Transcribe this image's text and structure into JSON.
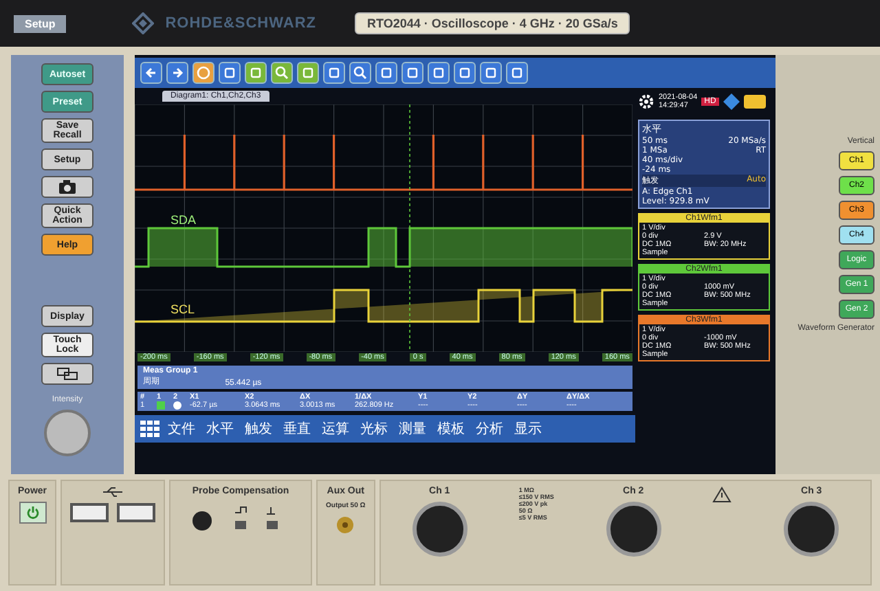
{
  "brand": "ROHDE&SCHWARZ",
  "model_label": "RTO2044 · Oscilloscope · 4 GHz · 20 GSa/s",
  "left_panel": {
    "title": "Setup",
    "buttons": [
      {
        "kind": "teal",
        "label": "Autoset"
      },
      {
        "kind": "teal",
        "label": "Preset"
      },
      {
        "kind": "grey",
        "label": "Save Recall"
      },
      {
        "kind": "grey",
        "label": "Setup"
      },
      {
        "kind": "camera"
      },
      {
        "kind": "grey",
        "label": "Quick Action"
      },
      {
        "kind": "orange",
        "label": "Help"
      },
      {
        "kind": "gap"
      },
      {
        "kind": "grey",
        "label": "Display"
      },
      {
        "kind": "light",
        "label": "Touch Lock"
      },
      {
        "kind": "windows"
      }
    ],
    "knob_label": "Intensity"
  },
  "screen": {
    "diagram_tab": "Diagram1: Ch1,Ch2,Ch3",
    "trace_labels": [
      "SDA",
      "SCL"
    ],
    "time_ticks": [
      "-200 ms",
      "-160 ms",
      "-120 ms",
      "-80 ms",
      "-40 ms",
      "0 s",
      "40 ms",
      "80 ms",
      "120 ms",
      "160 ms"
    ],
    "meas_group": {
      "title": "Meas Group 1",
      "row_label": "周期",
      "value": "55.442 µs"
    },
    "cursor_table": {
      "columns": [
        "#",
        "1",
        "2",
        "X1",
        "X2",
        "ΔX",
        "1/ΔX",
        "Y1",
        "Y2",
        "ΔY",
        "ΔY/ΔX"
      ],
      "row_index": "1",
      "row": [
        "-62.7 µs",
        "3.0643 ms",
        "3.0013 ms",
        "262.809 Hz",
        "----",
        "----",
        "----",
        "----"
      ]
    },
    "menu": [
      "文件",
      "水平",
      "触发",
      "垂直",
      "运算",
      "光标",
      "测量",
      "模板",
      "分析",
      "显示"
    ],
    "side_panel": {
      "date": "2021-08-04",
      "time": "14:29:47",
      "hd_badge": "HD",
      "horizontal": {
        "title": "水平",
        "rows": [
          [
            "50 ms",
            "20 MSa/s"
          ],
          [
            "1 MSa",
            "RT"
          ],
          [
            "40 ms/div",
            ""
          ],
          [
            "-24 ms",
            ""
          ]
        ]
      },
      "trigger": {
        "title": "触发",
        "mode": "Auto",
        "source": "A:   Edge  Ch1",
        "level": "Level: 929.8 mV"
      },
      "channels": [
        {
          "name": "Ch1Wfm1",
          "color": "#e8d23a",
          "scale": "1 V/div",
          "offset": "0 div",
          "coupling": "DC 1MΩ",
          "acq": "Sample",
          "value": "2.9 V",
          "bw": "BW: 20 MHz"
        },
        {
          "name": "Ch2Wfm1",
          "color": "#5ec83a",
          "scale": "1 V/div",
          "offset": "0 div",
          "coupling": "DC 1MΩ",
          "acq": "Sample",
          "value": "1000 mV",
          "bw": "BW: 500 MHz"
        },
        {
          "name": "Ch3Wfm1",
          "color": "#e8782a",
          "scale": "1 V/div",
          "offset": "0 div",
          "coupling": "DC 1MΩ",
          "acq": "Sample",
          "value": "-1000 mV",
          "bw": "BW: 500 MHz"
        }
      ]
    }
  },
  "right_panel": {
    "vertical_label": "Vertical",
    "channel_buttons": [
      {
        "label": "Ch1",
        "color": "#f0e040"
      },
      {
        "label": "Ch2",
        "color": "#6ee04a"
      },
      {
        "label": "Ch3",
        "color": "#f09030"
      },
      {
        "label": "Ch4",
        "color": "#a0e0f0"
      }
    ],
    "extra_buttons": [
      "Logic",
      "Gen 1",
      "Gen 2"
    ],
    "generator_label": "Waveform Generator"
  },
  "bottom_panel": {
    "power": "Power",
    "probe_compensation": "Probe Compensation",
    "aux_out": "Aux Out",
    "aux_output": "Output 50 Ω",
    "inputs": [
      "Ch 1",
      "Ch 2",
      "Ch 3"
    ],
    "input_spec": [
      "1 MΩ",
      "≤150 V RMS",
      "≤200 V pk",
      "50 Ω",
      "≤5 V RMS"
    ]
  }
}
